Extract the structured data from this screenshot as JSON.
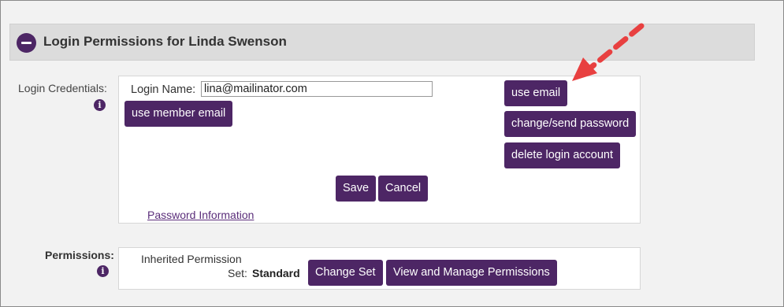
{
  "section": {
    "title": "Login Permissions for Linda Swenson"
  },
  "credentials": {
    "label": "Login Credentials:",
    "login_name_label": "Login Name:",
    "login_name_value": "lina@mailinator.com",
    "use_member_email": "use member email",
    "use_email": "use email",
    "change_send_password": "change/send password",
    "delete_login_account": "delete login account",
    "save": "Save",
    "cancel": "Cancel",
    "password_info_link": "Password Information"
  },
  "permissions": {
    "label": "Permissions:",
    "inherited_line1": "Inherited Permission",
    "inherited_line2": "Set:",
    "set_value": "Standard",
    "change_set": "Change Set",
    "view_manage": "View and Manage Permissions"
  },
  "icons": {
    "info": "i"
  },
  "colors": {
    "accent": "#4d2665",
    "arrow": "#e84040"
  }
}
